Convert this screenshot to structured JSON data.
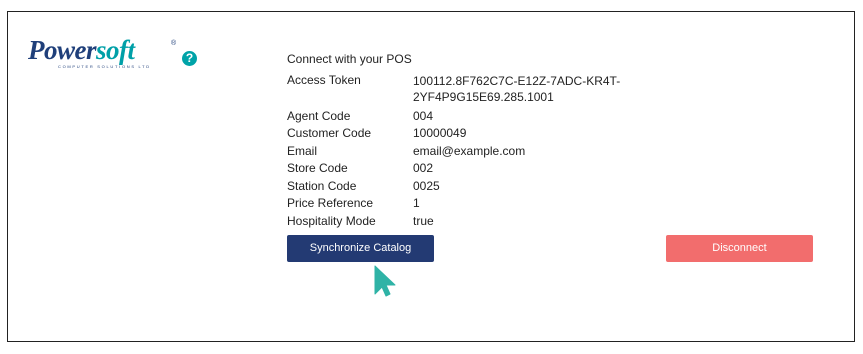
{
  "brand": {
    "logo_part1": "Power",
    "logo_part2": "soft",
    "registered_mark": "®",
    "tagline": "COMPUTER SOLUTIONS LTD",
    "help_icon": "question-circle-icon",
    "help_glyph": "?"
  },
  "connection": {
    "heading": "Connect with your POS",
    "access_token_label": "Access Token",
    "access_token_value": "100112.8F762C7C-E12Z-7ADC-KR4T-2YF4P9G15E69.285.1001",
    "fields": [
      {
        "label": "Agent Code",
        "value": "004"
      },
      {
        "label": "Customer Code",
        "value": "10000049"
      },
      {
        "label": "Email",
        "value": "email@example.com"
      },
      {
        "label": "Store Code",
        "value": "002"
      },
      {
        "label": "Station Code",
        "value": "0025"
      },
      {
        "label": "Price Reference",
        "value": "1"
      },
      {
        "label": "Hospitality Mode",
        "value": "true"
      }
    ]
  },
  "actions": {
    "sync_label": "Synchronize Catalog",
    "disconnect_label": "Disconnect"
  },
  "colors": {
    "primary_button": "#233a73",
    "danger_button": "#f26d6d",
    "brand_navy": "#1f3f7a",
    "brand_teal": "#00a0a8",
    "cursor": "#2fb3a6"
  },
  "cursor_icon": "mouse-pointer-icon"
}
